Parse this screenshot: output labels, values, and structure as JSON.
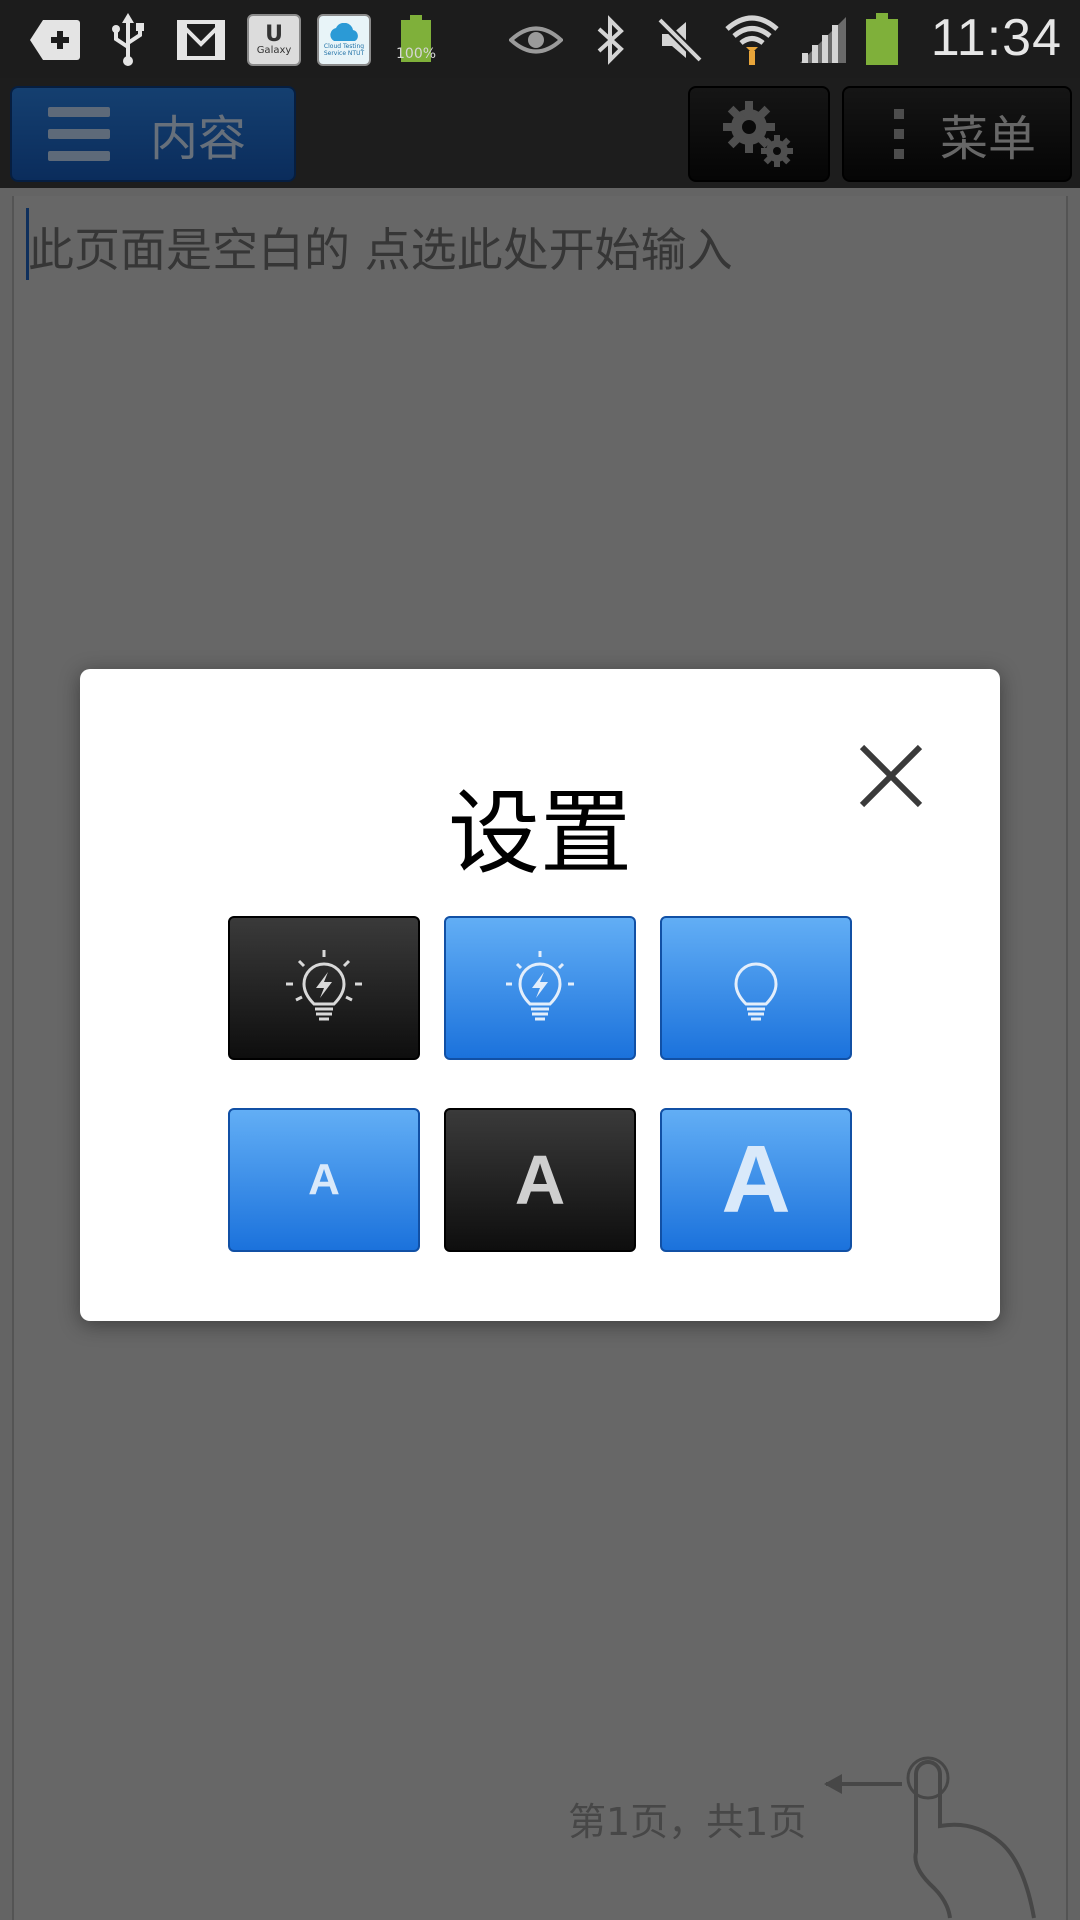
{
  "status_bar": {
    "time": "11:34",
    "battery_notification_text": "100%",
    "galaxy_app_label": "Galaxy",
    "cloud_app_label": "Cloud Testing Service NTUT",
    "icons": [
      "add-notification-icon",
      "usb-icon",
      "gmail-icon",
      "galaxy-app-icon",
      "cloud-testing-icon",
      "battery-full-notification-icon",
      "smart-stay-eye-icon",
      "bluetooth-icon",
      "mute-icon",
      "wifi-icon",
      "signal-icon",
      "battery-icon"
    ]
  },
  "app": {
    "contents_button_label": "内容",
    "menu_button_label": "菜单",
    "page_placeholder": "此页面是空白的 点选此处开始输入",
    "page_indicator": "第1页，共1页",
    "accent_color": "#1b72dc"
  },
  "dialog": {
    "title": "设置",
    "brightness_options": [
      {
        "icon": "bright-bulb-icon",
        "selected": true
      },
      {
        "icon": "medium-bulb-icon",
        "selected": false
      },
      {
        "icon": "dim-bulb-icon",
        "selected": false
      }
    ],
    "font_size_options": [
      {
        "label": "A",
        "size": "small",
        "selected": false
      },
      {
        "label": "A",
        "size": "medium",
        "selected": true
      },
      {
        "label": "A",
        "size": "large",
        "selected": false
      }
    ]
  }
}
